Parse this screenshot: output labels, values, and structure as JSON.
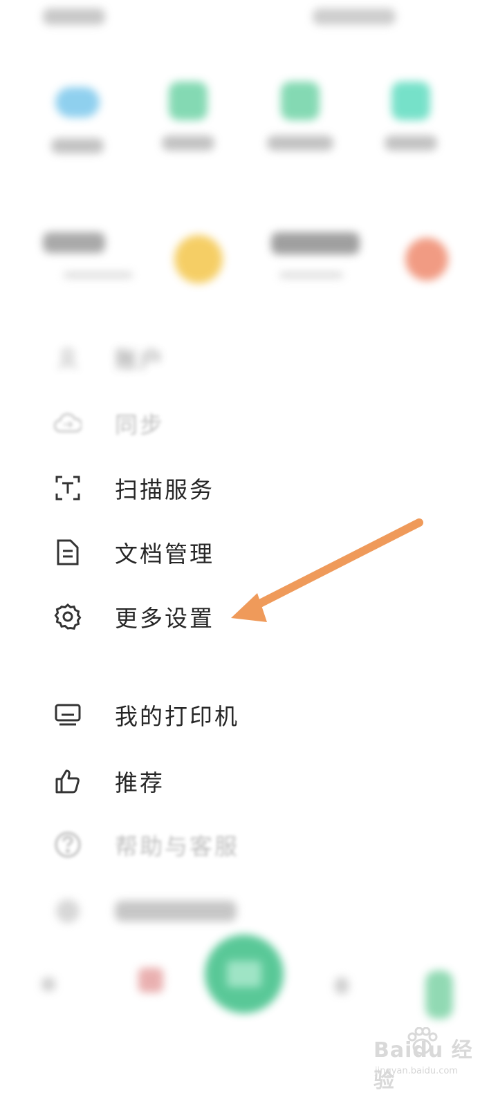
{
  "menu": {
    "items": [
      {
        "label": "账户",
        "icon": "user-icon",
        "state": "blurred"
      },
      {
        "label": "同步",
        "icon": "cloud-sync-icon",
        "state": "faded"
      },
      {
        "label": "扫描服务",
        "icon": "scan-text-icon",
        "state": "normal"
      },
      {
        "label": "文档管理",
        "icon": "document-icon",
        "state": "normal"
      },
      {
        "label": "更多设置",
        "icon": "gear-icon",
        "state": "normal"
      },
      {
        "label": "我的打印机",
        "icon": "printer-icon",
        "state": "normal"
      },
      {
        "label": "推荐",
        "icon": "thumbs-up-icon",
        "state": "normal"
      },
      {
        "label": "帮助与客服",
        "icon": "help-icon",
        "state": "faded"
      },
      {
        "label": "",
        "icon": "info-icon",
        "state": "blurred"
      }
    ]
  },
  "annotation": {
    "color": "#ef9a5a",
    "points_to": "更多设置"
  },
  "colors": {
    "fab": "#3dbf86",
    "tile_cloud": "#7cc8ec",
    "tile_green": "#6fd3a6",
    "circle_yellow": "#f4c64b",
    "circle_red": "#ef8a6e"
  },
  "watermark": {
    "main": "Baidu 经验",
    "sub": "jingyan.baidu.com"
  }
}
